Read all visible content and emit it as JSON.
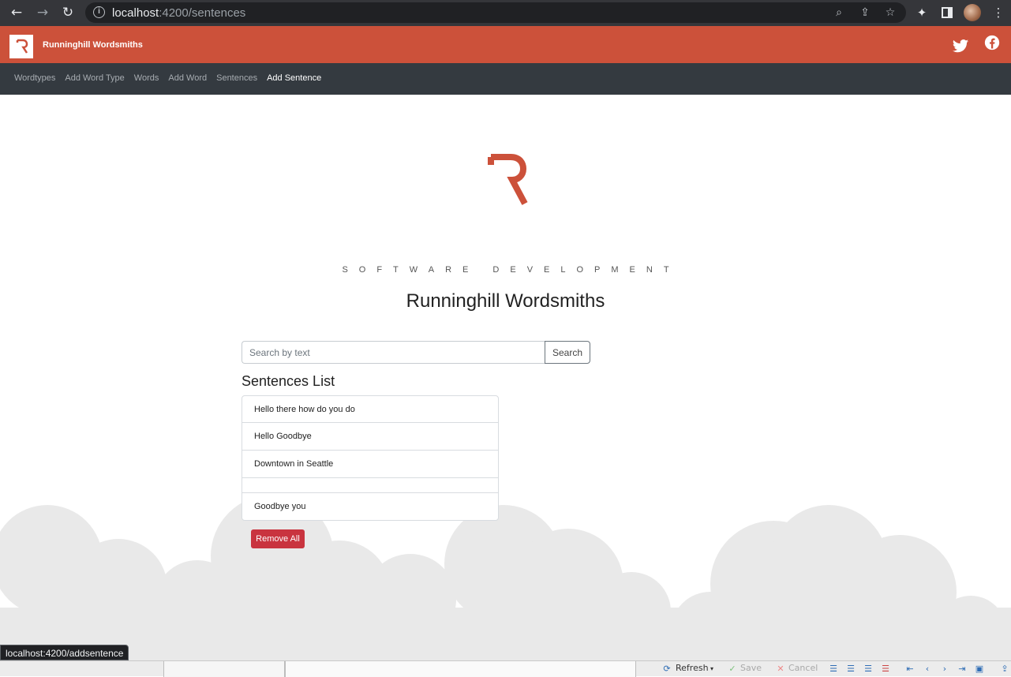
{
  "browser": {
    "url_host": "localhost",
    "url_rest": ":4200/sentences",
    "status_url": "localhost:4200/addsentence"
  },
  "header": {
    "brand": "Runninghill Wordsmiths",
    "brand_color": "#cc513a"
  },
  "nav": {
    "items": [
      {
        "label": "Wordtypes"
      },
      {
        "label": "Add Word Type"
      },
      {
        "label": "Words"
      },
      {
        "label": "Add Word"
      },
      {
        "label": "Sentences"
      },
      {
        "label": "Add Sentence"
      }
    ],
    "active": "Add Sentence"
  },
  "hero": {
    "tagline": "SOFTWARE DEVELOPMENT",
    "title": "Runninghill Wordsmiths"
  },
  "search": {
    "placeholder": "Search by text",
    "value": "",
    "button_label": "Search"
  },
  "sentences": {
    "heading": "Sentences List",
    "items": [
      "Hello there how do you do",
      "Hello Goodbye",
      "Downtown in Seattle",
      "",
      "Goodbye you"
    ],
    "remove_all_label": "Remove All"
  },
  "ide_toolbar": {
    "refresh_label": "Refresh",
    "save_label": "Save",
    "cancel_label": "Cancel"
  },
  "colors": {
    "danger": "#c9343f",
    "subnav_bg": "#343a40"
  }
}
